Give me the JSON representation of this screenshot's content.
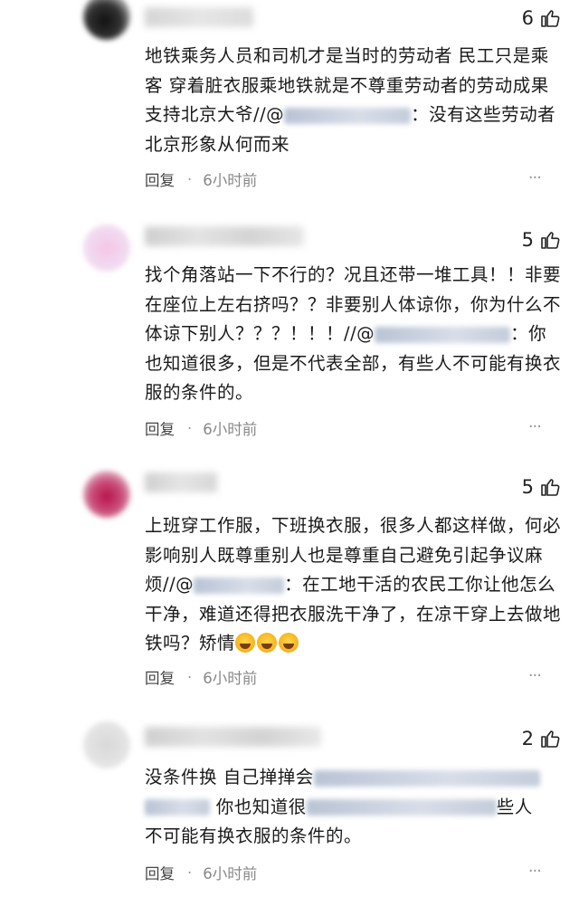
{
  "comments": [
    {
      "likes": "6",
      "text_part1": "地铁乘务人员和司机才是当时的劳动者 民工只是乘客 穿着脏衣服乘地铁就是不尊重劳动者的劳动成果 支持北京大爷//@",
      "text_part2": "：没有这些劳动者北京形象从何而来",
      "reply": "回复",
      "time": "6小时前"
    },
    {
      "likes": "5",
      "text_part1": "找个角落站一下不行的？况且还带一堆工具！！非要在座位上左右挤吗？？非要别人体谅你，你为什么不体谅下别人？？？！！！//@",
      "text_part2": "：你也知道很多，但是不代表全部，有些人不可能有换衣服的条件的。",
      "reply": "回复",
      "time": "6小时前"
    },
    {
      "likes": "5",
      "text_part1": "上班穿工作服，下班换衣服，很多人都这样做，何必影响别人既尊重别人也是尊重自己避免引起争议麻烦//@",
      "text_part2": "：在工地干活的农民工你让他怎么干净，难道还得把衣服洗干净了，在凉干穿上去做地铁吗？矫情",
      "reply": "回复",
      "time": "6小时前"
    },
    {
      "likes": "2",
      "line1": "没条件换 自己掸掸会",
      "line2_a": "",
      "line2_b": "你也知道很",
      "line2_c": "些人",
      "line3": "不可能有换衣服的条件的。",
      "reply": "回复",
      "time": "6小时前"
    }
  ],
  "colors": {
    "text": "#1a1a1a",
    "meta": "#888888"
  }
}
